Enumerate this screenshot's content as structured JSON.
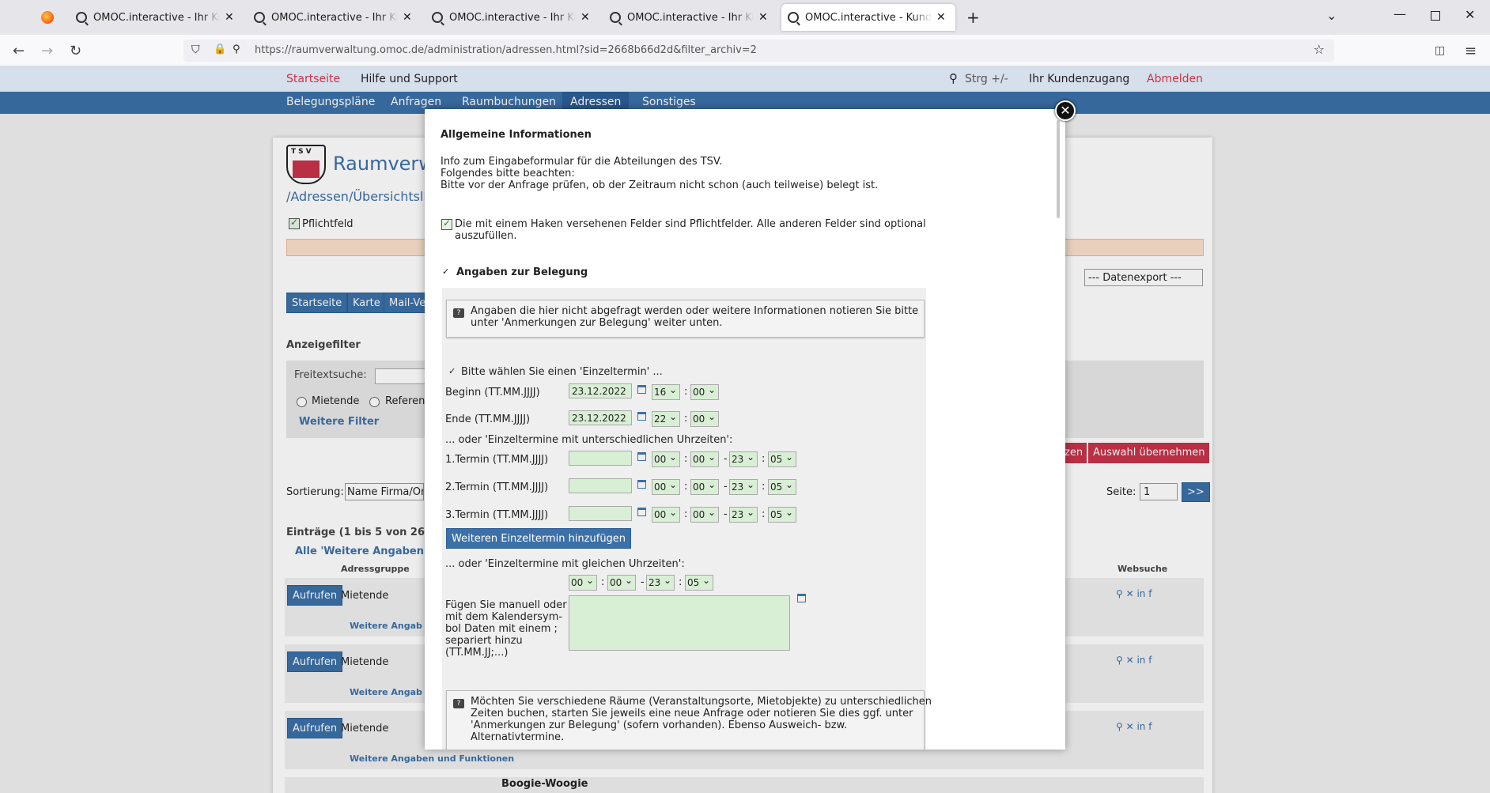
{
  "browser": {
    "tabs": [
      {
        "label": "OMOC.interactive - Ihr Kundenzugang"
      },
      {
        "label": "OMOC.interactive - Ihr Kundenzugang"
      },
      {
        "label": "OMOC.interactive - Ihr Kundenzugang"
      },
      {
        "label": "OMOC.interactive - Ihr Kundenzugang"
      },
      {
        "label": "OMOC.interactive - Kundenzugang"
      }
    ],
    "url": "https://raumverwaltung.omoc.de/administration/adressen.html?sid=2668b66d2d&filter_archiv=2"
  },
  "topbar": {
    "home": "Startseite",
    "help": "Hilfe und Support",
    "zoom": "Strg +/-",
    "account": "Ihr Kundenzugang",
    "logout": "Abmelden"
  },
  "menu": {
    "items": [
      "Belegungspläne",
      "Anfragen",
      "Raumbuchungen",
      "Adressen",
      "Sonstiges"
    ]
  },
  "page": {
    "title": "Raumverwa",
    "breadcrumb": "/Adressen/Übersichtsliste",
    "required": "Pflichtfeld",
    "buttons": [
      "Startseite",
      "Karte",
      "Mail-Ve"
    ],
    "export": "--- Datenexport ---",
    "filter_heading": "Anzeigefilter",
    "freetext_label": "Freitextsuche:",
    "radio1": "Mietende",
    "radio2": "Referen",
    "more_filter": "Weitere Filter",
    "apply_partial": "zen",
    "apply": "Auswahl übernehmen",
    "sort_label": "Sortierung:",
    "sort_value": "Name Firma/Org",
    "page_label": "Seite:",
    "page_value": "1",
    "next": ">>",
    "entries": "Einträge (1 bis 5 von 26)",
    "all_more": "Alle 'Weitere Angaben un",
    "col_group": "Adressgruppe",
    "col_web": "Websuche",
    "rows": [
      {
        "button": "Aufrufen",
        "group": "Mietende",
        "more": "Weitere Angab"
      },
      {
        "button": "Aufrufen",
        "group": "Mietende",
        "more": "Weitere Angab"
      },
      {
        "button": "Aufrufen",
        "group": "Mietende",
        "more": "Weitere Angaben und Funktionen"
      }
    ],
    "last_row_name": "Boogie-Woogie"
  },
  "modal": {
    "heading": "Allgemeine Informationen",
    "info_lines": [
      "Info zum Eingabeformular für die Abteilungen des TSV.",
      "Folgendes bitte beachten:",
      "Bitte vor der Anfrage prüfen, ob der Zeitraum nicht schon (auch teilweise) belegt ist."
    ],
    "required_note_1": "Die mit einem Haken versehenen Felder sind Pflichtfelder. Alle anderen Felder sind optional",
    "required_note_2": "auszufüllen.",
    "section": "Angaben zur Belegung",
    "hint1_1": "Angaben die hier nicht abgefragt werden oder weitere Informationen notieren Sie bitte",
    "hint1_2": "unter 'Anmerkungen zur Belegung' weiter unten.",
    "single_heading": "Bitte wählen Sie einen 'Einzeltermin' ...",
    "begin_label": "Beginn (TT.MM.JJJJ)",
    "begin_date": "23.12.2022",
    "begin_h": "16",
    "begin_m": "00",
    "end_label": "Ende (TT.MM.JJJJ)",
    "end_date": "23.12.2022",
    "end_h": "22",
    "end_m": "00",
    "multi_heading": "... oder 'Einzeltermine mit unterschiedlichen Uhrzeiten':",
    "terms": [
      {
        "label": "1.Termin (TT.MM.JJJJ)",
        "h1": "00",
        "m1": "00",
        "h2": "23",
        "m2": "05"
      },
      {
        "label": "2.Termin (TT.MM.JJJJ)",
        "h1": "00",
        "m1": "00",
        "h2": "23",
        "m2": "05"
      },
      {
        "label": "3.Termin (TT.MM.JJJJ)",
        "h1": "00",
        "m1": "00",
        "h2": "23",
        "m2": "05"
      }
    ],
    "add_button": "Weiteren Einzeltermin hinzufügen",
    "same_heading": "... oder 'Einzeltermine mit gleichen Uhrzeiten':",
    "same": {
      "h1": "00",
      "m1": "00",
      "h2": "23",
      "m2": "05"
    },
    "manual_lines": [
      "Fügen Sie manuell oder",
      "mit dem Kalendersym-",
      "bol Daten mit einem ;",
      "separiert hinzu",
      "(TT.MM.JJ;...)"
    ],
    "hint2_lines": [
      "Möchten Sie verschiedene Räume (Veranstaltungsorte, Mietobjekte) zu unterschiedlichen",
      "Zeiten buchen, starten Sie jeweils eine neue Anfrage oder notieren Sie dies ggf. unter",
      "'Anmerkungen zur Belegung' (sofern vorhanden). Ebenso Ausweich- bzw.",
      "Alternativtermine."
    ]
  }
}
